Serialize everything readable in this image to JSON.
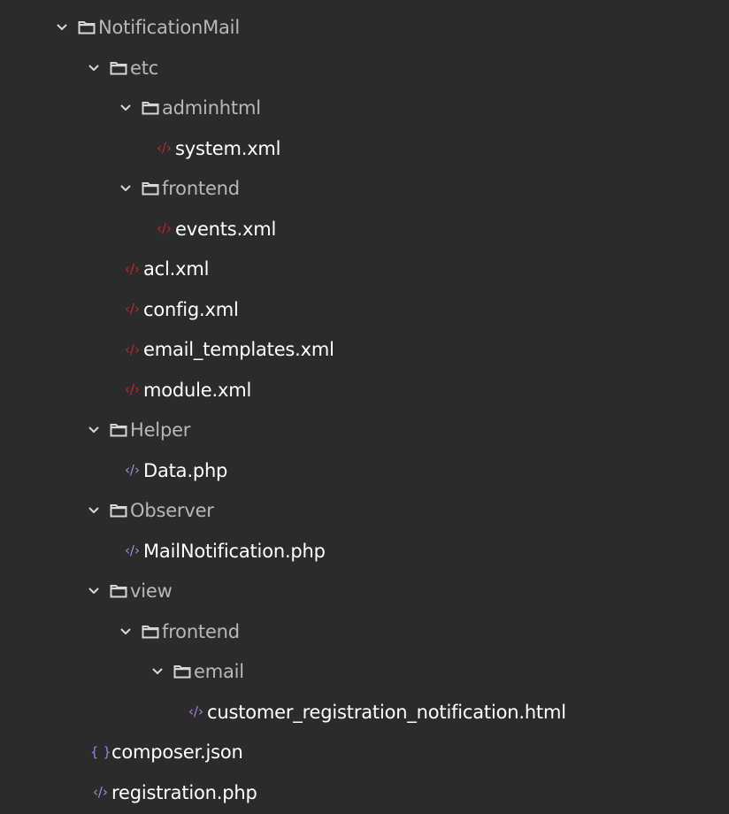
{
  "colors": {
    "background": "#2b2b2b",
    "folder_text": "#b6b8bb",
    "file_text": "#ffffff",
    "xml_icon": "#c1272d",
    "php_icon": "#9c8fe0",
    "json_icon": "#a57fd6",
    "html_icon": "#a57fd6",
    "chevron": "#d7d7d7",
    "folder_icon": "#d7d7d7"
  },
  "tree": [
    {
      "type": "folder",
      "label": "NotificationMail",
      "level": 0,
      "expanded": true,
      "slug": "notificationmail"
    },
    {
      "type": "folder",
      "label": "etc",
      "level": 1,
      "expanded": true,
      "slug": "etc"
    },
    {
      "type": "folder",
      "label": "adminhtml",
      "level": 2,
      "expanded": true,
      "slug": "adminhtml"
    },
    {
      "type": "file",
      "label": "system.xml",
      "level": 3,
      "icon": "xml-icon",
      "slug": "system-xml"
    },
    {
      "type": "folder",
      "label": "frontend",
      "level": 2,
      "expanded": true,
      "slug": "frontend-etc"
    },
    {
      "type": "file",
      "label": "events.xml",
      "level": 3,
      "icon": "xml-icon",
      "slug": "events-xml"
    },
    {
      "type": "file",
      "label": "acl.xml",
      "level": 2,
      "icon": "xml-icon",
      "slug": "acl-xml"
    },
    {
      "type": "file",
      "label": "config.xml",
      "level": 2,
      "icon": "xml-icon",
      "slug": "config-xml"
    },
    {
      "type": "file",
      "label": "email_templates.xml",
      "level": 2,
      "icon": "xml-icon",
      "slug": "email-templates-xml"
    },
    {
      "type": "file",
      "label": "module.xml",
      "level": 2,
      "icon": "xml-icon",
      "slug": "module-xml"
    },
    {
      "type": "folder",
      "label": "Helper",
      "level": 1,
      "expanded": true,
      "slug": "helper"
    },
    {
      "type": "file",
      "label": "Data.php",
      "level": 2,
      "icon": "php-icon",
      "slug": "data-php"
    },
    {
      "type": "folder",
      "label": "Observer",
      "level": 1,
      "expanded": true,
      "slug": "observer"
    },
    {
      "type": "file",
      "label": "MailNotification.php",
      "level": 2,
      "icon": "php-icon",
      "slug": "mailnotification-php"
    },
    {
      "type": "folder",
      "label": "view",
      "level": 1,
      "expanded": true,
      "slug": "view"
    },
    {
      "type": "folder",
      "label": "frontend",
      "level": 2,
      "expanded": true,
      "slug": "frontend-view"
    },
    {
      "type": "folder",
      "label": "email",
      "level": 3,
      "expanded": true,
      "slug": "email"
    },
    {
      "type": "file",
      "label": "customer_registration_notification.html",
      "level": 4,
      "icon": "html-icon",
      "slug": "customer-registration-notification-html"
    },
    {
      "type": "file",
      "label": "composer.json",
      "level": 1,
      "icon": "json-icon",
      "slug": "composer-json"
    },
    {
      "type": "file",
      "label": "registration.php",
      "level": 1,
      "icon": "php-icon",
      "slug": "registration-php"
    }
  ]
}
